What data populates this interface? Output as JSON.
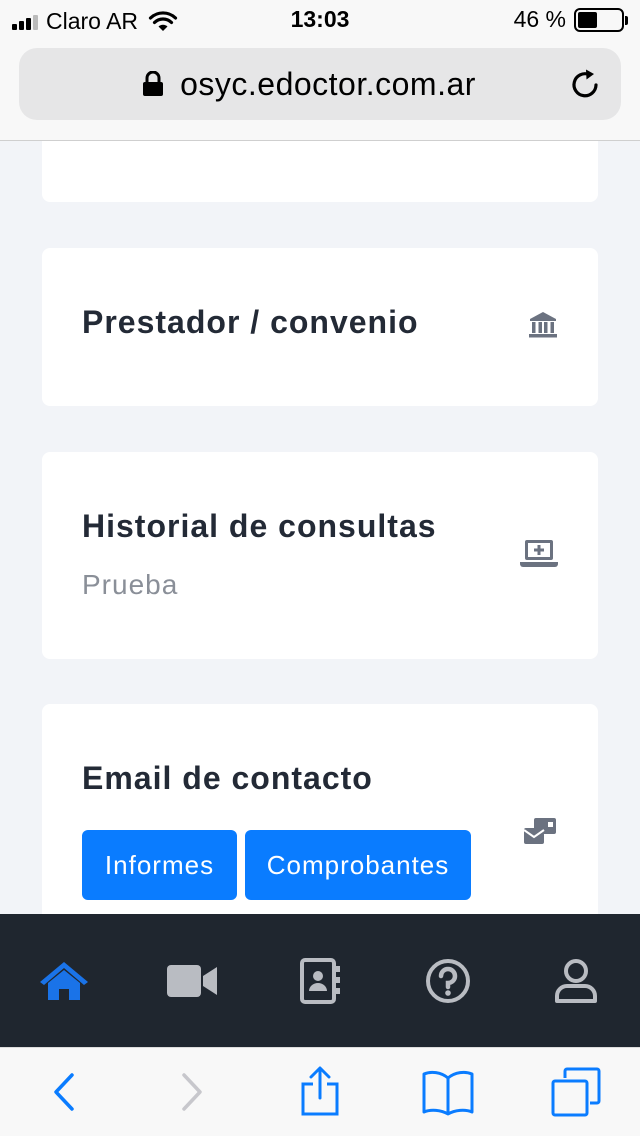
{
  "status_bar": {
    "carrier": "Claro AR",
    "time": "13:03",
    "battery_percent": "46 %",
    "battery_level": 0.46
  },
  "browser": {
    "url": "osyc.edoctor.com.ar"
  },
  "cards": [
    {
      "title": "Prestador / convenio",
      "icon": "bank-icon"
    },
    {
      "title": "Historial de consultas",
      "subtitle": "Prueba",
      "icon": "laptop-medical-icon"
    },
    {
      "title": "Email de contacto",
      "icon": "mail-bulk-icon",
      "buttons": [
        "Informes",
        "Comprobantes"
      ]
    }
  ],
  "app_nav": {
    "items": [
      {
        "name": "home-icon",
        "active": true
      },
      {
        "name": "video-icon",
        "active": false
      },
      {
        "name": "contacts-icon",
        "active": false
      },
      {
        "name": "help-icon",
        "active": false
      },
      {
        "name": "user-icon",
        "active": false
      }
    ],
    "active_color": "#1a73e8",
    "inactive_color": "#b9bcc2"
  },
  "safari_toolbar": {
    "items": [
      "back-icon",
      "forward-icon",
      "share-icon",
      "bookmarks-icon",
      "tabs-icon"
    ],
    "accent": "#0a7cff"
  }
}
